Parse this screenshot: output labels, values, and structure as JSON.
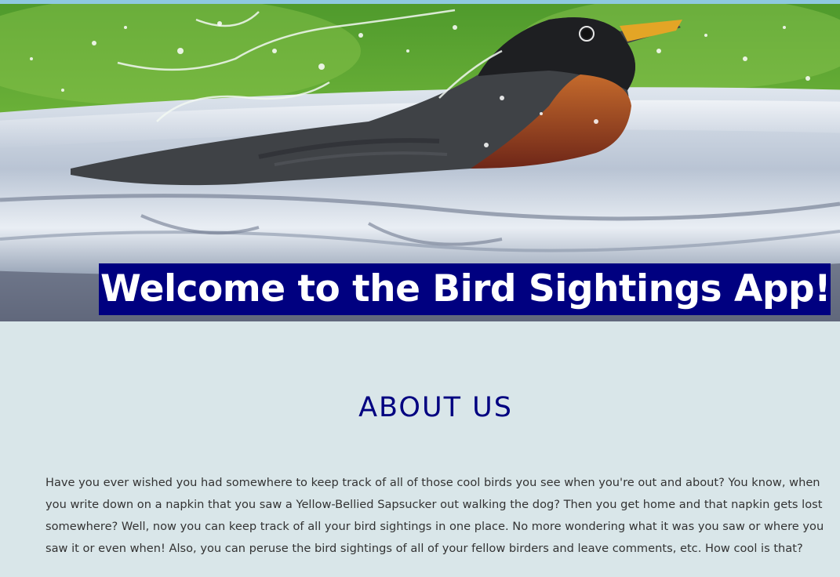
{
  "hero": {
    "image_alt": "Robin splashing in a bird bath",
    "title": "Welcome to the Bird Sightings App!"
  },
  "about": {
    "heading": "ABOUT US",
    "body": "Have you ever wished you had somewhere to keep track of all of those cool birds you see when you're out and about? You know, when you write down on a napkin that you saw a Yellow-Bellied Sapsucker out walking the dog? Then you get home and that napkin gets lost somewhere? Well, now you can keep track of all your bird sightings in one place. No more wondering what it was you saw or where you saw it or even when! Also, you can peruse the bird sightings of all of your fellow birders and leave comments, etc. How cool is that?"
  },
  "colors": {
    "accent": "#000080",
    "page_background": "#d9e6e9",
    "body_text": "#333333"
  }
}
